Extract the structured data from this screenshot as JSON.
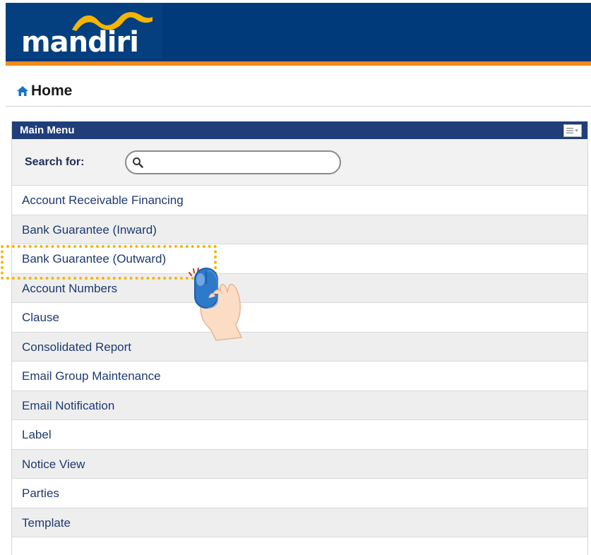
{
  "header": {
    "logo_text": "mandiri",
    "colors": {
      "bar": "#003a7a",
      "stripe": "#f08a1c",
      "logo_swoosh": "#f5b400"
    }
  },
  "breadcrumb": {
    "icon": "home-icon",
    "label": "Home"
  },
  "panel": {
    "title": "Main Menu",
    "menu_button_icon": "list-menu-icon",
    "search": {
      "label": "Search for:",
      "icon": "search-icon",
      "value": "",
      "placeholder": ""
    },
    "items": [
      "Account Receivable Financing",
      "Bank Guarantee (Inward)",
      "Bank Guarantee (Outward)",
      "Account Numbers",
      "Clause",
      "Consolidated Report",
      "Email Group Maintenance",
      "Email Notification",
      "Label",
      "Notice View",
      "Parties",
      "Template"
    ]
  },
  "overlay": {
    "highlighted_item": "Bank Guarantee (Outward)",
    "cursor_icon": "hand-mouse-click-icon"
  }
}
